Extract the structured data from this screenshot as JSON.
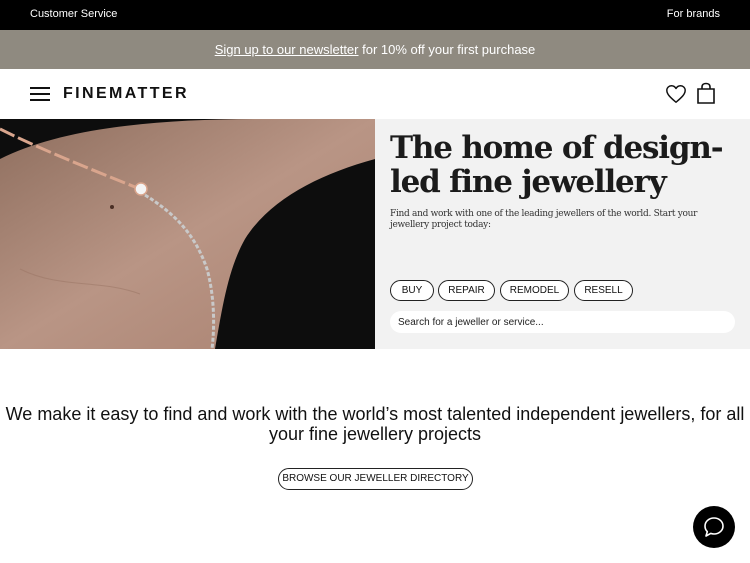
{
  "topbar": {
    "customer_service": "Customer Service",
    "for_brands": "For brands"
  },
  "promo": {
    "link_text": "Sign up to our newsletter",
    "rest_text": " for 10% off your first purchase"
  },
  "header": {
    "logo": "FINEMATTER",
    "icons": [
      "menu-icon",
      "heart-icon",
      "bag-icon"
    ]
  },
  "hero": {
    "title": "The home of design-led fine jewellery",
    "subtitle": "Find and work with one of the leading jewellers of the world. Start your jewellery project today:",
    "chips": [
      "BUY",
      "REPAIR",
      "REMODEL",
      "RESELL"
    ],
    "search_placeholder": "Search for a jeweller or service..."
  },
  "intro": {
    "tagline": "We make it easy to find and work with the world’s most talented independent jewellers, for all your fine jewellery projects",
    "button": "BROWSE OUR JEWELLER DIRECTORY"
  },
  "chat": {
    "icon": "chat-bubble-icon"
  },
  "colors": {
    "topbar": "#000000",
    "promo": "#8f8a80",
    "hero_panel": "#f2f2f2"
  }
}
